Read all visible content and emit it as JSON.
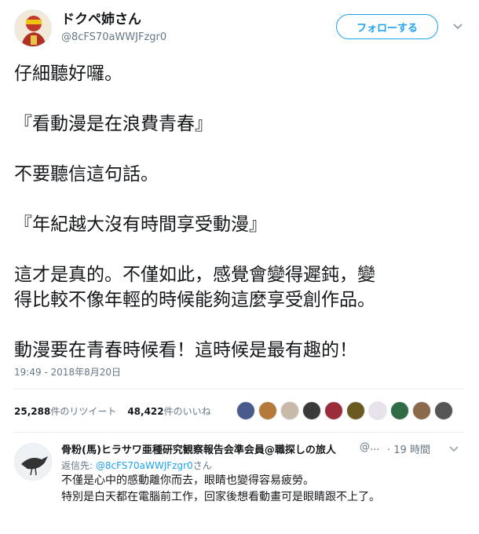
{
  "author": {
    "display_name": "ドクペ姉さん",
    "handle": "@8cFS70aWWJFzgr0"
  },
  "follow_button_label": "フォローする",
  "tweet": {
    "paragraphs": [
      "仔細聽好囉。",
      "『看動漫是在浪費青春』",
      "不要聽信這句話。",
      "『年紀越大沒有時間享受動漫』",
      "這才是真的。不僅如此，感覺會變得遲鈍，變\n得比較不像年輕的時候能夠這麼享受創作品。",
      "動漫要在青春時候看！這時候是最有趣的！"
    ],
    "timestamp": "19:49 - 2018年8月20日"
  },
  "stats": {
    "retweets_count": "25,288",
    "retweets_label": "件のリツイート",
    "likes_count": "48,422",
    "likes_label": "件のいいね"
  },
  "liker_avatar_colors": [
    "#4a5a8a",
    "#b5793a",
    "#c9b9a8",
    "#3a3a3a",
    "#9b2d3a",
    "#6b5a1f",
    "#e8e2ea",
    "#2f6b45",
    "#8a6a4a",
    "#555555"
  ],
  "reply": {
    "display_name": "骨粉(馬)ヒラサワ亜種研究観察報告会準会員@職探しの旅人",
    "handle": "@...",
    "time": "· 19 時間",
    "reply_to_label": "返信先:",
    "reply_to_handle": "@8cFS70aWWJFzgr0",
    "reply_to_suffix": "さん",
    "lines": [
      "不僅是心中的感動離你而去，眼睛也變得容易疲勞。",
      "特別是白天都在電腦前工作，回家後想看動畫可是眼睛跟不上了。"
    ]
  },
  "colors": {
    "accent": "#1da1f2",
    "secondary_text": "#657786",
    "primary_text": "#14171a",
    "divider": "#e6ecf0"
  }
}
